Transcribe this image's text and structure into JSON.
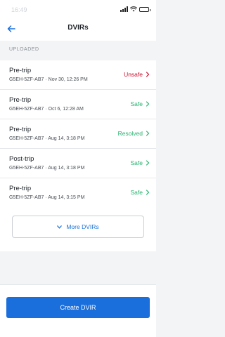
{
  "status_bar": {
    "time": "16:49"
  },
  "header": {
    "title": "DVIRs"
  },
  "section": {
    "title": "UPLOADED"
  },
  "colors": {
    "unsafe": "#c8102e",
    "safe": "#23b26d",
    "resolved": "#23b26d",
    "accent": "#1a6fdc"
  },
  "dvirs": [
    {
      "type": "Pre-trip",
      "vehicle": "G5EH-5ZF-AB7",
      "datetime": "Nov 30, 12:26 PM",
      "status": "Unsafe"
    },
    {
      "type": "Pre-trip",
      "vehicle": "G5EH-5ZF-AB7",
      "datetime": "Oct 6, 12:28 AM",
      "status": "Safe"
    },
    {
      "type": "Pre-trip",
      "vehicle": "G5EH-5ZF-AB7",
      "datetime": "Aug 14, 3:18 PM",
      "status": "Resolved"
    },
    {
      "type": "Post-trip",
      "vehicle": "G5EH-5ZF-AB7",
      "datetime": "Aug 14, 3:18 PM",
      "status": "Safe"
    },
    {
      "type": "Pre-trip",
      "vehicle": "G5EH-5ZF-AB7",
      "datetime": "Aug 14, 3:15 PM",
      "status": "Safe"
    }
  ],
  "more_button": {
    "label": "More DVIRs"
  },
  "footer": {
    "create_label": "Create DVIR"
  }
}
